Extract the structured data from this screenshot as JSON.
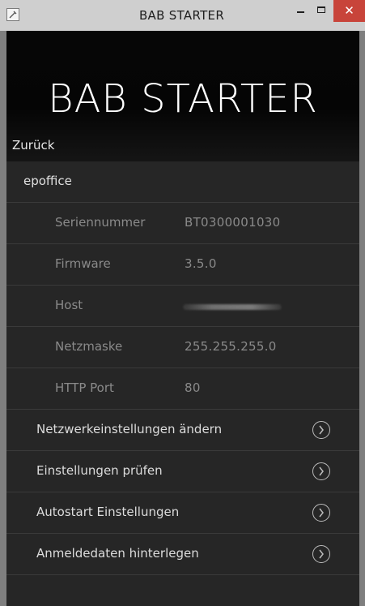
{
  "window": {
    "title": "BAB STARTER",
    "close_glyph": "✕"
  },
  "header": {
    "title": "BAB STARTER",
    "back_label": "Zurück"
  },
  "section": {
    "label": "epoffice"
  },
  "details": [
    {
      "label": "Seriennummer",
      "value": "BT0300001030"
    },
    {
      "label": "Firmware",
      "value": "3.5.0"
    },
    {
      "label": "Host",
      "value": ""
    },
    {
      "label": "Netzmaske",
      "value": "255.255.255.0"
    },
    {
      "label": "HTTP Port",
      "value": "80"
    }
  ],
  "actions": [
    {
      "label": "Netzwerkeinstellungen ändern",
      "icon": "chevron-right-circle-icon"
    },
    {
      "label": "Einstellungen prüfen",
      "icon": "chevron-right-circle-icon"
    },
    {
      "label": "Autostart Einstellungen",
      "icon": "chevron-right-circle-icon"
    },
    {
      "label": "Anmeldedaten hinterlegen",
      "icon": "chevron-right-circle-icon"
    }
  ],
  "colors": {
    "titlebar": "#cfcfcf",
    "close": "#c8443a",
    "panel": "#262626",
    "header": "#050505",
    "divider": "#3a3a3a"
  }
}
